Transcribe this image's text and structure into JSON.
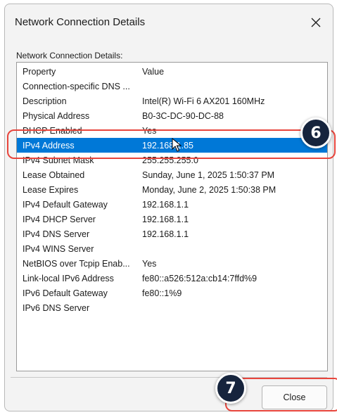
{
  "window": {
    "title": "Network Connection Details",
    "close_glyph": "close-icon"
  },
  "group_label": "Network Connection Details:",
  "table": {
    "headers": {
      "property": "Property",
      "value": "Value"
    },
    "rows": [
      {
        "property": "Connection-specific DNS ...",
        "value": ""
      },
      {
        "property": "Description",
        "value": "Intel(R) Wi-Fi 6 AX201 160MHz"
      },
      {
        "property": "Physical Address",
        "value": "B0-3C-DC-90-DC-88"
      },
      {
        "property": "DHCP Enabled",
        "value": "Yes"
      },
      {
        "property": "IPv4 Address",
        "value": "192.168.1.85",
        "selected": true
      },
      {
        "property": "IPv4 Subnet Mask",
        "value": "255.255.255.0"
      },
      {
        "property": "Lease Obtained",
        "value": "Sunday, June 1, 2025 1:50:37 PM"
      },
      {
        "property": "Lease Expires",
        "value": "Monday, June 2, 2025 1:50:38 PM"
      },
      {
        "property": "IPv4 Default Gateway",
        "value": "192.168.1.1"
      },
      {
        "property": "IPv4 DHCP Server",
        "value": "192.168.1.1"
      },
      {
        "property": "IPv4 DNS Server",
        "value": "192.168.1.1"
      },
      {
        "property": "IPv4 WINS Server",
        "value": ""
      },
      {
        "property": "NetBIOS over Tcpip Enab...",
        "value": "Yes"
      },
      {
        "property": "Link-local IPv6 Address",
        "value": "fe80::a526:512a:cb14:7ffd%9"
      },
      {
        "property": "IPv6 Default Gateway",
        "value": "fe80::1%9"
      },
      {
        "property": "IPv6 DNS Server",
        "value": ""
      }
    ]
  },
  "buttons": {
    "close_label": "Close"
  },
  "annotations": {
    "step_6": "6",
    "step_7": "7",
    "accent_color": "#e8453c",
    "badge_color": "#16243d",
    "selection_color": "#0078d7"
  }
}
